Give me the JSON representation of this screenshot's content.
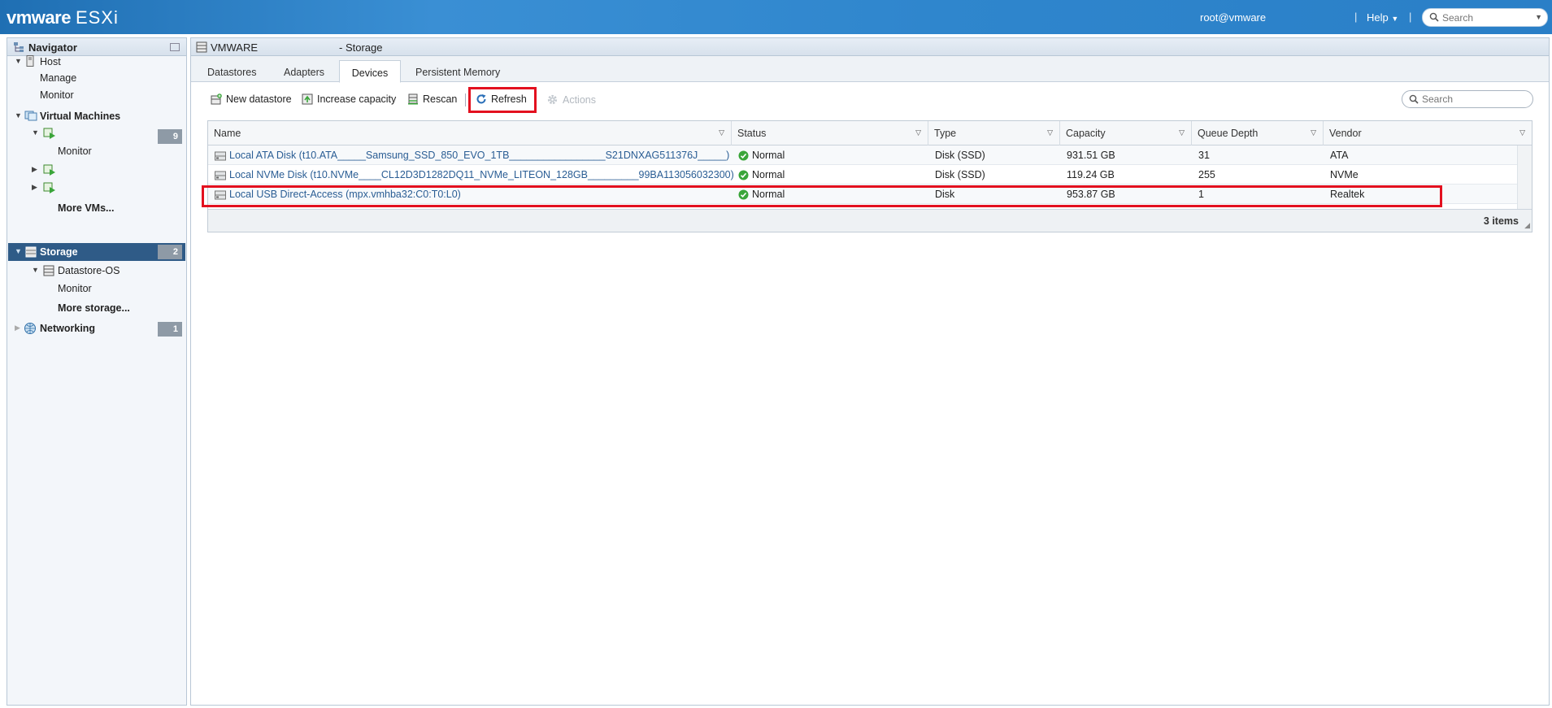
{
  "header": {
    "brand": "vmware",
    "product": "ESXi",
    "user": "root@vmware",
    "help": "Help",
    "search_placeholder": "Search"
  },
  "navigator": {
    "title": "Navigator",
    "host": "Host",
    "host_manage": "Manage",
    "host_monitor": "Monitor",
    "vms": "Virtual Machines",
    "vms_count": "9",
    "vm_monitor": "Monitor",
    "more_vms": "More VMs...",
    "storage": "Storage",
    "storage_count": "2",
    "datastore": "Datastore-OS",
    "datastore_monitor": "Monitor",
    "more_storage": "More storage...",
    "networking": "Networking",
    "networking_count": "1"
  },
  "main": {
    "host_name": "VMWARE",
    "title_suffix": "- Storage",
    "tabs": [
      {
        "label": "Datastores"
      },
      {
        "label": "Adapters"
      },
      {
        "label": "Devices"
      },
      {
        "label": "Persistent Memory"
      }
    ],
    "active_tab": "Devices",
    "toolbar": {
      "new_datastore": "New datastore",
      "increase_capacity": "Increase capacity",
      "rescan": "Rescan",
      "refresh": "Refresh",
      "actions": "Actions"
    },
    "search_placeholder": "Search"
  },
  "devices_table": {
    "columns": [
      "Name",
      "Status",
      "Type",
      "Capacity",
      "Queue Depth",
      "Vendor"
    ],
    "rows": [
      {
        "name": "Local ATA Disk (t10.ATA_____Samsung_SSD_850_EVO_1TB_________________S21DNXAG511376J_____)",
        "status": "Normal",
        "type": "Disk (SSD)",
        "capacity": "931.51 GB",
        "queue_depth": "31",
        "vendor": "ATA"
      },
      {
        "name": "Local NVMe Disk (t10.NVMe____CL12D3D1282DQ11_NVMe_LITEON_128GB_________99BA113056032300)",
        "status": "Normal",
        "type": "Disk (SSD)",
        "capacity": "119.24 GB",
        "queue_depth": "255",
        "vendor": "NVMe"
      },
      {
        "name": "Local USB Direct-Access (mpx.vmhba32:C0:T0:L0)",
        "status": "Normal",
        "type": "Disk",
        "capacity": "953.87 GB",
        "queue_depth": "1",
        "vendor": "Realtek"
      }
    ],
    "footer_count": "3 items"
  },
  "colors": {
    "header_blue": "#2f86cd",
    "selected_nav": "#2f5b87",
    "highlight_red": "#e3101f",
    "status_green": "#3aa53a",
    "link_blue": "#2a5d94"
  }
}
